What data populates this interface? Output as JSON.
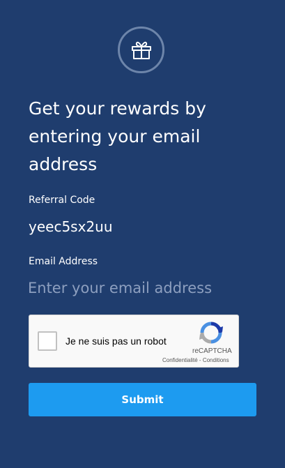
{
  "icon": "gift-icon",
  "heading": "Get your rewards by entering your email address",
  "referral": {
    "label": "Referral Code",
    "value": "yeec5sx2uu"
  },
  "email": {
    "label": "Email Address",
    "placeholder": "Enter your email address",
    "value": ""
  },
  "recaptcha": {
    "label": "Je ne suis pas un robot",
    "brand": "reCAPTCHA",
    "privacy": "Confidentialité",
    "separator": " - ",
    "terms": "Conditions",
    "checked": false
  },
  "submit_label": "Submit",
  "colors": {
    "background": "#1f3d6e",
    "accent": "#1d9bf0",
    "placeholder": "#8d9fbf",
    "badge_ring": "#6d85aa"
  }
}
